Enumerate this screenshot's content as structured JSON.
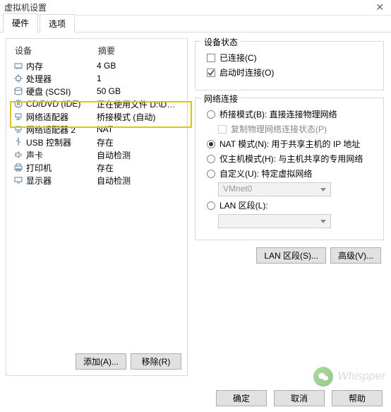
{
  "window": {
    "title": "虚拟机设置"
  },
  "tabs": {
    "hardware": "硬件",
    "options": "选项"
  },
  "left": {
    "header_device": "设备",
    "header_summary": "摘要",
    "devices": [
      {
        "icon": "memory-icon",
        "name": "内存",
        "summary": "4 GB"
      },
      {
        "icon": "cpu-icon",
        "name": "处理器",
        "summary": "1"
      },
      {
        "icon": "disk-icon",
        "name": "硬盘 (SCSI)",
        "summary": "50 GB"
      },
      {
        "icon": "cd-icon",
        "name": "CD/DVD (IDE)",
        "summary": "正在使用文件 D:\\Download\\Ku..."
      },
      {
        "icon": "network-icon",
        "name": "网络适配器",
        "summary": "桥接模式 (自动)"
      },
      {
        "icon": "network-icon",
        "name": "网络适配器 2",
        "summary": "NAT"
      },
      {
        "icon": "usb-icon",
        "name": "USB 控制器",
        "summary": "存在"
      },
      {
        "icon": "sound-icon",
        "name": "声卡",
        "summary": "自动检测"
      },
      {
        "icon": "printer-icon",
        "name": "打印机",
        "summary": "存在"
      },
      {
        "icon": "display-icon",
        "name": "显示器",
        "summary": "自动检测"
      }
    ],
    "add_button": "添加(A)...",
    "remove_button": "移除(R)"
  },
  "right": {
    "status_group": "设备状态",
    "connected": "已连接(C)",
    "connect_on_power": "启动时连接(O)",
    "conn_group": "网络连接",
    "bridge": "桥接模式(B): 直接连接物理网络",
    "bridge_sub": "复制物理网络连接状态(P)",
    "nat": "NAT 模式(N): 用于共享主机的 IP 地址",
    "hostonly": "仅主机模式(H): 与主机共享的专用网络",
    "custom": "自定义(U): 特定虚拟网络",
    "custom_value": "VMnet0",
    "lan": "LAN 区段(L):",
    "lan_value": "",
    "lan_segments_btn": "LAN 区段(S)...",
    "advanced_btn": "高级(V)..."
  },
  "footer": {
    "ok": "确定",
    "cancel": "取消",
    "help": "帮助"
  },
  "watermark": {
    "text": "Whispper"
  }
}
